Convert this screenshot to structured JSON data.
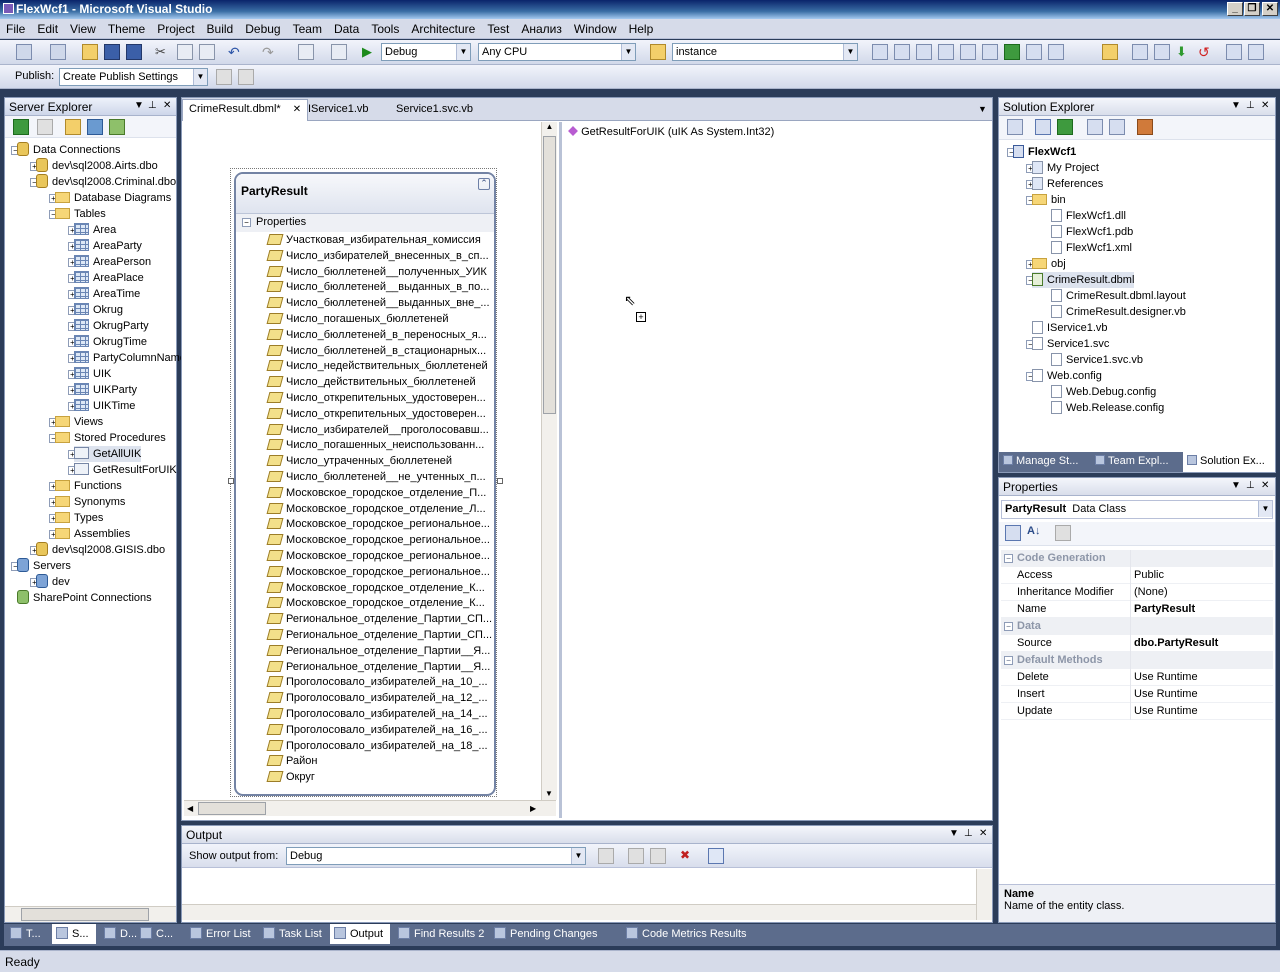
{
  "window": {
    "title": "FlexWcf1 - Microsoft Visual Studio"
  },
  "menu": [
    "File",
    "Edit",
    "View",
    "Theme",
    "Project",
    "Build",
    "Debug",
    "Team",
    "Data",
    "Tools",
    "Architecture",
    "Test",
    "Анализ",
    "Window",
    "Help"
  ],
  "toolbar": {
    "config": "Debug",
    "platform": "Any CPU",
    "find": "instance",
    "publish_label": "Publish:",
    "publish_value": "Create Publish Settings"
  },
  "server_explorer": {
    "title": "Server Explorer",
    "nodes": [
      "Data Connections",
      "dev\\sql2008.Airts.dbo",
      "dev\\sql2008.Criminal.dbo",
      "Database Diagrams",
      "Tables",
      "Area",
      "AreaParty",
      "AreaPerson",
      "AreaPlace",
      "AreaTime",
      "Okrug",
      "OkrugParty",
      "OkrugTime",
      "PartyColumnName",
      "UIK",
      "UIKParty",
      "UIKTime",
      "Views",
      "Stored Procedures",
      "GetAllUIK",
      "GetResultForUIK",
      "Functions",
      "Synonyms",
      "Types",
      "Assemblies",
      "dev\\sql2008.GISIS.dbo",
      "Servers",
      "dev",
      "SharePoint Connections"
    ]
  },
  "doc_tabs": [
    "CrimeResult.dbml*",
    "IService1.vb",
    "Service1.svc.vb"
  ],
  "entity": {
    "name": "PartyResult",
    "section": "Properties",
    "props": [
      "Участковая_избирательная_комиссия",
      "Число_избирателей_внесенных_в_сп...",
      "Число_бюллетеней__полученных_УИК",
      "Число_бюллетеней__выданных_в_по...",
      "Число_бюллетеней__выданных_вне_...",
      "Число_погашеных_бюллетеней",
      "Число_бюллетеней_в_переносных_я...",
      "Число_бюллетеней_в_стационарных...",
      "Число_недействительных_бюллетеней",
      "Число_действительных_бюллетеней",
      "Число_открепительных_удостоверен...",
      "Число_открепительных_удостоверен...",
      "Число_избирателей__проголосовавш...",
      "Число_погашенных_неиспользованн...",
      "Число_утраченных_бюллетеней",
      "Число_бюллетеней__не_учтенных_п...",
      "Московское_городское_отделение_П...",
      "Московское_городское_отделение_Л...",
      "Московское_городское_региональное...",
      "Московское_городское_региональное...",
      "Московское_городское_региональное...",
      "Московское_городское_региональное...",
      "Московское_городское_отделение_К...",
      "Московское_городское_отделение_К...",
      "Региональное_отделение_Партии_СП...",
      "Региональное_отделение_Партии_СП...",
      "Региональное_отделение_Партии__Я...",
      "Региональное_отделение_Партии__Я...",
      "Проголосовало_избирателей_на_10_...",
      "Проголосовало_избирателей_на_12_...",
      "Проголосовало_избирателей_на_14_...",
      "Проголосовало_избирателей_на_16_...",
      "Проголосовало_избирателей_на_18_...",
      "Район",
      "Округ"
    ]
  },
  "methods_pane": {
    "item": "GetResultForUIK (uIK As System.Int32)"
  },
  "solution_explorer": {
    "title": "Solution Explorer",
    "nodes": [
      "FlexWcf1",
      "My Project",
      "References",
      "bin",
      "FlexWcf1.dll",
      "FlexWcf1.pdb",
      "FlexWcf1.xml",
      "obj",
      "CrimeResult.dbml",
      "CrimeResult.dbml.layout",
      "CrimeResult.designer.vb",
      "IService1.vb",
      "Service1.svc",
      "Service1.svc.vb",
      "Web.config",
      "Web.Debug.config",
      "Web.Release.config"
    ],
    "tabs": [
      "Manage St...",
      "Team Expl...",
      "Solution Ex..."
    ]
  },
  "properties": {
    "title": "Properties",
    "object": "PartyResult",
    "object_type": "Data Class",
    "rows": [
      {
        "cat": "Code Generation"
      },
      {
        "k": "Access",
        "v": "Public"
      },
      {
        "k": "Inheritance Modifier",
        "v": "(None)"
      },
      {
        "k": "Name",
        "v": "PartyResult",
        "bold": true
      },
      {
        "cat": "Data"
      },
      {
        "k": "Source",
        "v": "dbo.PartyResult",
        "bold": true
      },
      {
        "cat": "Default Methods"
      },
      {
        "k": "Delete",
        "v": "Use Runtime"
      },
      {
        "k": "Insert",
        "v": "Use Runtime"
      },
      {
        "k": "Update",
        "v": "Use Runtime"
      }
    ],
    "desc_title": "Name",
    "desc_text": "Name of the entity class."
  },
  "output": {
    "title": "Output",
    "show_from_label": "Show output from:",
    "show_from_value": "Debug"
  },
  "bottom_tabs": [
    "T...",
    "S...",
    "D...",
    "C...",
    "Error List",
    "Task List",
    "Output",
    "Find Results 2",
    "Pending Changes",
    "Code Metrics Results"
  ],
  "status": "Ready"
}
